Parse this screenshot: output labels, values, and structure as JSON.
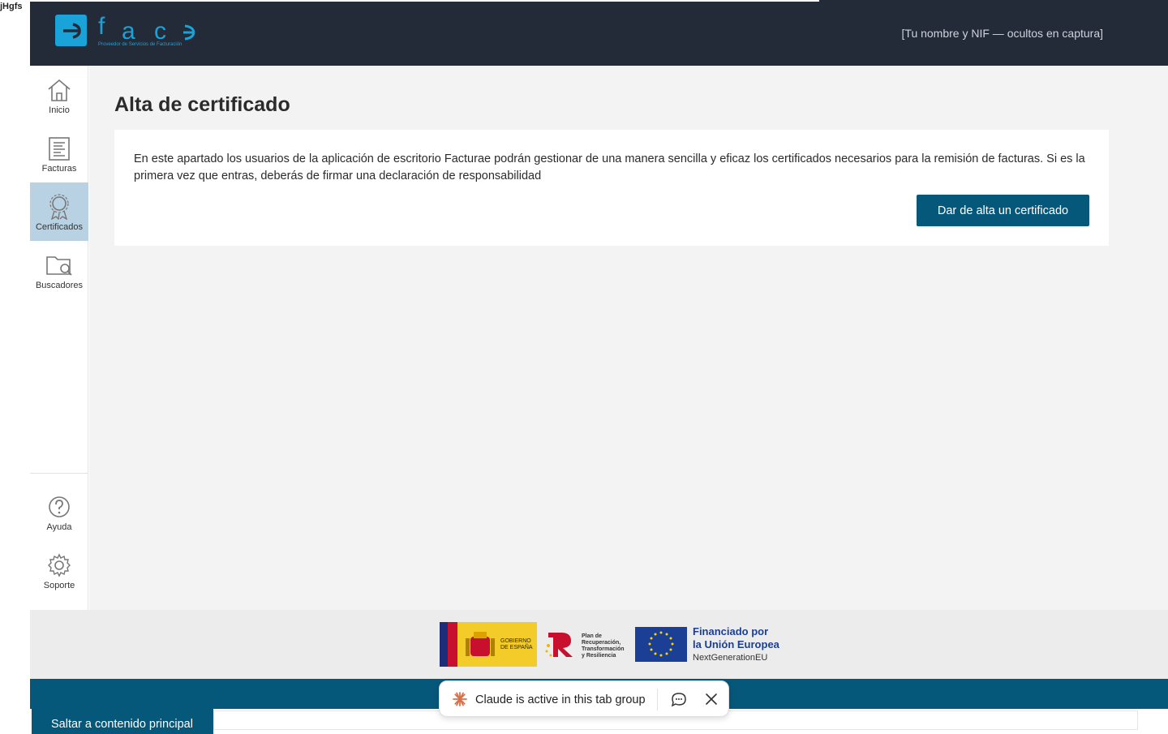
{
  "header": {
    "logo_letters": "f a c e",
    "logo_tagline": "Proveedor de Servicios de Facturación",
    "user_info": "[Tu nombre y NIF — ocultos en captura]"
  },
  "sidebar": {
    "items": [
      {
        "label": "Inicio",
        "icon": "home-icon"
      },
      {
        "label": "Facturas",
        "icon": "invoice-icon"
      },
      {
        "label": "Certificados",
        "icon": "certificate-icon",
        "active": true
      },
      {
        "label": "Buscadores",
        "icon": "folder-search-icon"
      }
    ],
    "bottom_items": [
      {
        "label": "Ayuda",
        "icon": "help-icon"
      },
      {
        "label": "Soporte",
        "icon": "gear-icon"
      }
    ]
  },
  "main": {
    "title": "Alta de certificado",
    "description": "En este apartado los usuarios de la aplicación de escritorio Facturae podrán gestionar de una manera sencilla y eficaz los certificados necesarios para la remisión de facturas. Si es la primera vez que entras, deberás de firmar una declaración de responsabilidad",
    "primary_button": "Dar de alta un certificado"
  },
  "footer": {
    "gobierno_line1": "GOBIERNO",
    "gobierno_line2": "DE ESPAÑA",
    "prtr_line1": "Plan de",
    "prtr_line2": "Recuperación,",
    "prtr_line3": "Transformación",
    "prtr_line4": "y Resiliencia",
    "eu_line1": "Financiado por",
    "eu_line2": "la Unión Europea",
    "eu_line3": "NextGenerationEU"
  },
  "skip_link": "Saltar a contenido principal",
  "claude_banner": {
    "text": "Claude is active in this tab group"
  },
  "colors": {
    "header_bg": "#232a38",
    "accent": "#06587a",
    "active_nav": "#b9d2e3",
    "logo_cyan": "#1aa3d9"
  }
}
